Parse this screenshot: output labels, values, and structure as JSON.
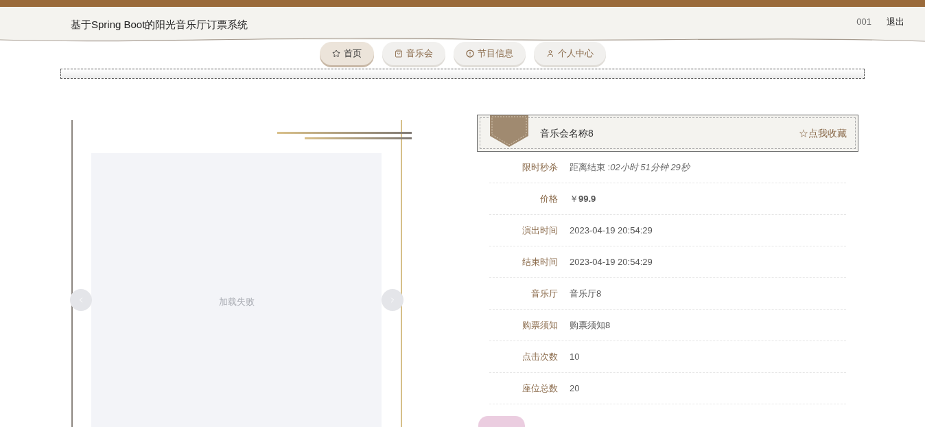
{
  "header": {
    "title": "基于Spring Boot的阳光音乐厅订票系统",
    "user": "001",
    "logout": "退出"
  },
  "nav": [
    {
      "label": "首页",
      "kind": "star",
      "selected": true
    },
    {
      "label": "音乐会",
      "kind": "bag",
      "selected": false
    },
    {
      "label": "节目信息",
      "kind": "alert",
      "selected": false
    },
    {
      "label": "个人中心",
      "kind": "user",
      "selected": false
    }
  ],
  "carousel": {
    "error_text": "加载失败"
  },
  "detail": {
    "name": "音乐会名称8",
    "favorite": "☆点我收藏",
    "rows": [
      {
        "label": "限时秒杀",
        "value": "距离结束 :*02小时 51分钟 29秒*",
        "kind": "countdown"
      },
      {
        "label": "价格",
        "value": "￥**99.9**",
        "kind": "price"
      },
      {
        "label": "演出时间",
        "value": "2023-04-19 20:54:29",
        "kind": "text"
      },
      {
        "label": "结束时间",
        "value": "2023-04-19 20:54:29",
        "kind": "text"
      },
      {
        "label": "音乐厅",
        "value": "音乐厅8",
        "kind": "text"
      },
      {
        "label": "购票须知",
        "value": "购票须知8",
        "kind": "text"
      },
      {
        "label": "点击次数",
        "value": "10",
        "kind": "text"
      },
      {
        "label": "座位总数",
        "value": "20",
        "kind": "text"
      }
    ]
  }
}
